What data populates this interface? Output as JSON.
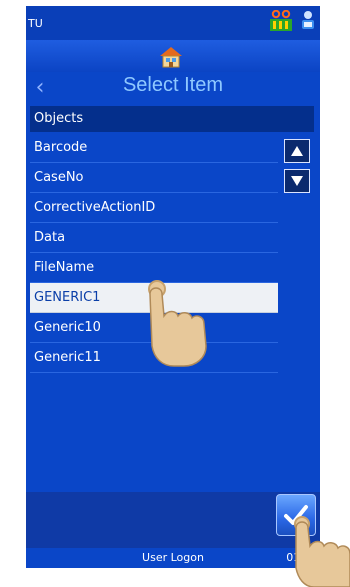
{
  "status": {
    "title": "TU"
  },
  "header": {
    "title": "Select Item"
  },
  "list": {
    "header": "Objects",
    "items": [
      "Barcode",
      "CaseNo",
      "CorrectiveActionID",
      "Data",
      "FileName",
      "GENERIC1",
      "Generic10",
      "Generic11"
    ],
    "selected": "GENERIC1"
  },
  "footer": {
    "user_logon": "User Logon",
    "clock": "01:02"
  },
  "icons": {
    "tray_left": "network-printer-icon",
    "tray_right": "user-device-icon",
    "home": "home-icon",
    "back": "back-arrow-icon",
    "scroll_up": "scroll-up-icon",
    "scroll_down": "scroll-down-icon",
    "confirm": "confirm-check-icon",
    "pointer": "tap-hand-icon"
  },
  "colors": {
    "background": "#0a46c8",
    "title": "#8ec8ff",
    "selected": "#eef1f5",
    "header": "#042f8c"
  }
}
